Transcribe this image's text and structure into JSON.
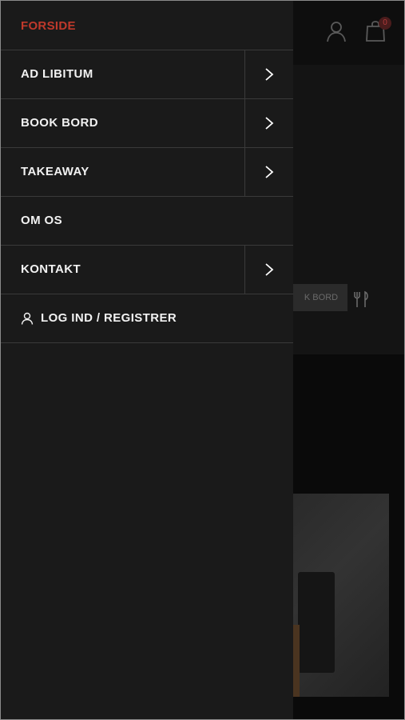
{
  "header": {
    "cart_count": "0",
    "icons": [
      "user-icon",
      "shopping-bag-icon"
    ]
  },
  "background": {
    "book_button_label": "K BORD",
    "icons": [
      "fork-knife-icon"
    ]
  },
  "drawer": {
    "home_label": "FORSIDE",
    "items": [
      {
        "label": "AD LIBITUM",
        "has_submenu": true
      },
      {
        "label": "BOOK BORD",
        "has_submenu": true
      },
      {
        "label": "TAKEAWAY",
        "has_submenu": true
      },
      {
        "label": "OM OS",
        "has_submenu": false
      },
      {
        "label": "KONTAKT",
        "has_submenu": true
      }
    ],
    "login_label": "LOG IND / REGISTRER"
  },
  "colors": {
    "accent": "#c0392b",
    "drawer_bg": "#1a1a1a",
    "divider": "#3a3a3a",
    "text": "#f2f2f2"
  }
}
